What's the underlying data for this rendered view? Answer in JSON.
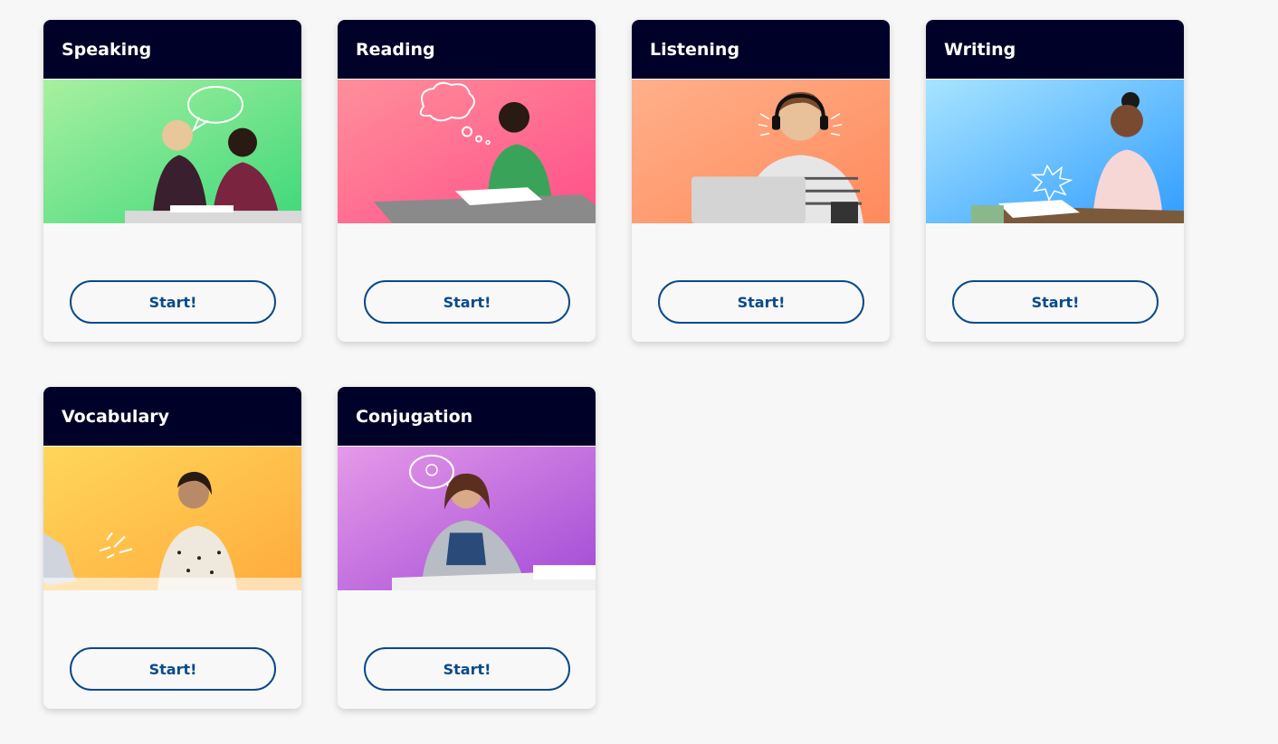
{
  "cards": [
    {
      "title": "Speaking",
      "button": "Start!",
      "image": "students-speaking-image",
      "colors": [
        "#a8f0a0",
        "#3fd87a"
      ]
    },
    {
      "title": "Reading",
      "button": "Start!",
      "image": "student-reading-image",
      "colors": [
        "#ff8f9a",
        "#ff4f8a"
      ]
    },
    {
      "title": "Listening",
      "button": "Start!",
      "image": "student-listening-image",
      "colors": [
        "#ffb08a",
        "#ff8a5c"
      ]
    },
    {
      "title": "Writing",
      "button": "Start!",
      "image": "student-writing-image",
      "colors": [
        "#a8e4ff",
        "#2f9dff"
      ]
    },
    {
      "title": "Vocabulary",
      "button": "Start!",
      "image": "student-vocabulary-image",
      "colors": [
        "#ffd65a",
        "#ffab3c"
      ]
    },
    {
      "title": "Conjugation",
      "button": "Start!",
      "image": "student-conjugation-image",
      "colors": [
        "#e59ae8",
        "#a24ad6"
      ]
    }
  ],
  "theme": {
    "header_bg": "#000128",
    "button_color": "#0a4a8a",
    "page_bg": "#f7f7f7"
  }
}
